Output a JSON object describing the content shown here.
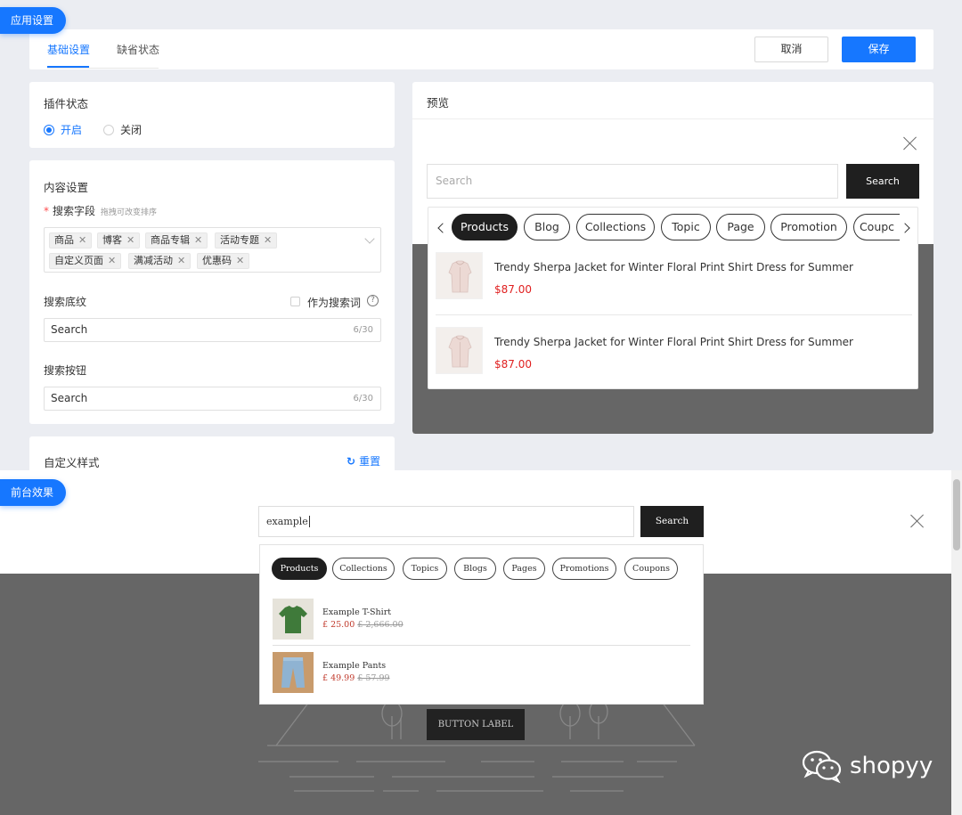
{
  "badges": {
    "app_settings": "应用设置",
    "storefront": "前台效果"
  },
  "tabs": [
    {
      "label": "基础设置",
      "active": true
    },
    {
      "label": "缺省状态",
      "active": false
    }
  ],
  "actions": {
    "cancel": "取消",
    "save": "保存"
  },
  "plugin_status": {
    "title": "插件状态",
    "options": [
      {
        "label": "开启",
        "selected": true
      },
      {
        "label": "关闭",
        "selected": false
      }
    ]
  },
  "content_settings": {
    "title": "内容设置",
    "search_fields": {
      "required_mark": "*",
      "label": "搜索字段",
      "hint": "拖拽可改变排序",
      "tags": [
        "商品",
        "博客",
        "商品专辑",
        "活动专题",
        "自定义页面",
        "满减活动",
        "优惠码"
      ]
    },
    "placeholder_text": {
      "label": "搜索底纹",
      "as_search_term_label": "作为搜索词",
      "help_icon": "?",
      "value": "Search",
      "counter": "6/30"
    },
    "search_button": {
      "label": "搜索按钮",
      "value": "Search",
      "counter": "6/30"
    }
  },
  "custom_style": {
    "title": "自定义样式",
    "reset_label": "重置"
  },
  "preview": {
    "title": "预览",
    "search_placeholder": "Search",
    "search_button": "Search",
    "pills": [
      "Products",
      "Blog",
      "Collections",
      "Topic",
      "Page",
      "Promotion",
      "Coupc"
    ],
    "active_pill": "Products",
    "items": [
      {
        "title": "Trendy Sherpa Jacket for Winter Floral Print Shirt Dress for Summer",
        "price": "$87.00"
      },
      {
        "title": "Trendy Sherpa Jacket for Winter Floral Print Shirt Dress for Summer",
        "price": "$87.00"
      }
    ]
  },
  "storefront": {
    "search_value": "example",
    "search_button": "Search",
    "pills": [
      "Products",
      "Collections",
      "Topics",
      "Blogs",
      "Pages",
      "Promotions",
      "Coupons"
    ],
    "active_pill": "Products",
    "items": [
      {
        "name": "Example T-Shirt",
        "price": "£ 25.00",
        "compare_price": "£ 2,666.00"
      },
      {
        "name": "Example Pants",
        "price": "£ 49.99",
        "compare_price": "£ 57.99"
      }
    ],
    "background_button": "BUTTON LABEL"
  },
  "watermark": "shopyy",
  "colors": {
    "accent": "#1677ff",
    "dark": "#1f1f1f",
    "price_red": "#e02020"
  }
}
